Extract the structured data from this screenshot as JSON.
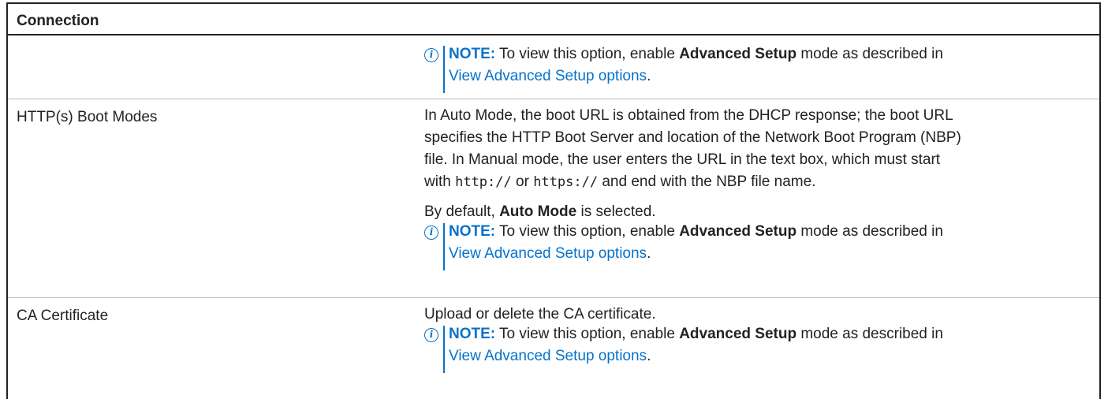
{
  "table": {
    "header": "Connection",
    "rows": [
      {
        "label": "",
        "note": {
          "tag": "NOTE:",
          "text_before": " To view this option, enable ",
          "bold": "Advanced Setup",
          "text_after": " mode as described in",
          "link": "View Advanced Setup options",
          "end": "."
        }
      },
      {
        "label": "HTTP(s) Boot Modes",
        "para1": {
          "line1": "In Auto Mode, the boot URL is obtained from the DHCP response; the boot URL",
          "line2": "specifies the HTTP Boot Server and location of the Network Boot Program (NBP)",
          "line3": "file. In Manual mode, the user enters the URL in the text box, which must start",
          "with": "with ",
          "code1": "http://",
          "or": " or ",
          "code2": "https://",
          "end": " and end with the NBP file name."
        },
        "para2": {
          "before": "By default, ",
          "bold": "Auto Mode",
          "after": " is selected."
        },
        "note": {
          "tag": "NOTE:",
          "text_before": " To view this option, enable ",
          "bold": "Advanced Setup",
          "text_after": " mode as described in",
          "link": "View Advanced Setup options",
          "end": "."
        }
      },
      {
        "label": "CA Certificate",
        "para1": "Upload or delete the CA certificate.",
        "note": {
          "tag": "NOTE:",
          "text_before": " To view this option, enable ",
          "bold": "Advanced Setup",
          "text_after": " mode as described in",
          "link": "View Advanced Setup options",
          "end": "."
        }
      }
    ]
  },
  "icons": {
    "note": "info-icon",
    "note_glyph": "i"
  },
  "colors": {
    "accent": "#0672cb",
    "text": "#222222",
    "rule": "#bdbdbd"
  }
}
